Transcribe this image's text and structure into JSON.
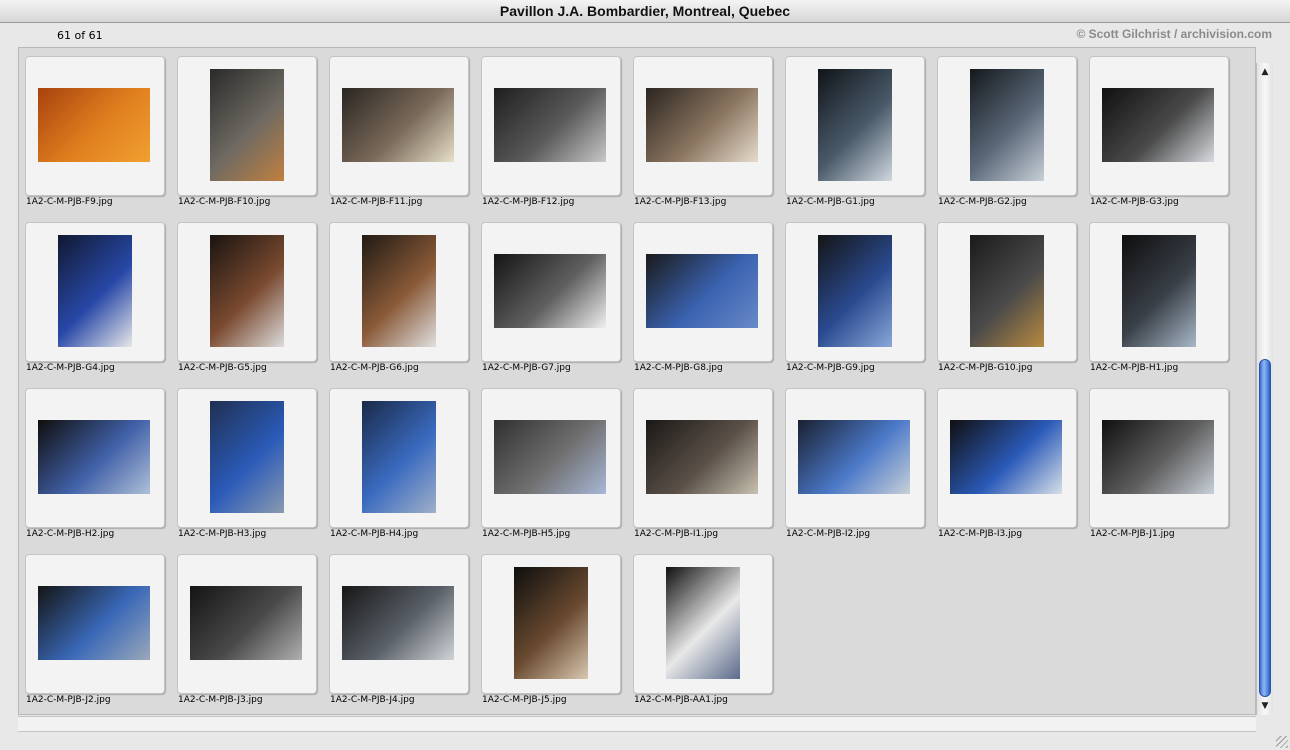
{
  "window": {
    "title": "Pavillon J.A. Bombardier, Montreal, Quebec"
  },
  "header": {
    "count": "61 of 61",
    "credit": "© Scott Gilchrist / archivision.com"
  },
  "thumbnails": [
    {
      "caption": "1A2-C-M-PJB-F9.jpg",
      "orientation": "landscape",
      "colors": [
        "#a8420e",
        "#e0801f",
        "#f0a030"
      ]
    },
    {
      "caption": "1A2-C-M-PJB-F10.jpg",
      "orientation": "portrait",
      "colors": [
        "#2a2a2a",
        "#6e6a62",
        "#c08040"
      ]
    },
    {
      "caption": "1A2-C-M-PJB-F11.jpg",
      "orientation": "landscape",
      "colors": [
        "#2a2622",
        "#7a6a5a",
        "#e8e0c8"
      ]
    },
    {
      "caption": "1A2-C-M-PJB-F12.jpg",
      "orientation": "landscape",
      "colors": [
        "#1e1e1e",
        "#5a5a5a",
        "#c8c8c8"
      ]
    },
    {
      "caption": "1A2-C-M-PJB-F13.jpg",
      "orientation": "landscape",
      "colors": [
        "#2c2520",
        "#8a7560",
        "#e6dccc"
      ]
    },
    {
      "caption": "1A2-C-M-PJB-G1.jpg",
      "orientation": "portrait",
      "colors": [
        "#101418",
        "#4a5a6a",
        "#d0d8e0"
      ]
    },
    {
      "caption": "1A2-C-M-PJB-G2.jpg",
      "orientation": "portrait",
      "colors": [
        "#14181c",
        "#5a6878",
        "#c8d0d8"
      ]
    },
    {
      "caption": "1A2-C-M-PJB-G3.jpg",
      "orientation": "landscape",
      "colors": [
        "#101010",
        "#4a4a4a",
        "#d8dce0"
      ]
    },
    {
      "caption": "1A2-C-M-PJB-G4.jpg",
      "orientation": "portrait",
      "colors": [
        "#101830",
        "#2848a8",
        "#e8e8e8"
      ]
    },
    {
      "caption": "1A2-C-M-PJB-G5.jpg",
      "orientation": "portrait",
      "colors": [
        "#1a1410",
        "#7a4a30",
        "#dcdcdc"
      ]
    },
    {
      "caption": "1A2-C-M-PJB-G6.jpg",
      "orientation": "portrait",
      "colors": [
        "#201a14",
        "#8a5a38",
        "#e0e0e0"
      ]
    },
    {
      "caption": "1A2-C-M-PJB-G7.jpg",
      "orientation": "landscape",
      "colors": [
        "#141414",
        "#606060",
        "#f0f0f0"
      ]
    },
    {
      "caption": "1A2-C-M-PJB-G8.jpg",
      "orientation": "landscape",
      "colors": [
        "#1a1a1a",
        "#3a62b0",
        "#6a8ac8"
      ]
    },
    {
      "caption": "1A2-C-M-PJB-G9.jpg",
      "orientation": "portrait",
      "colors": [
        "#141414",
        "#2a4a90",
        "#8aa8d8"
      ]
    },
    {
      "caption": "1A2-C-M-PJB-G10.jpg",
      "orientation": "portrait",
      "colors": [
        "#1a1a1a",
        "#4a4a4a",
        "#b88a40"
      ]
    },
    {
      "caption": "1A2-C-M-PJB-H1.jpg",
      "orientation": "portrait",
      "colors": [
        "#0e0e0e",
        "#3a4048",
        "#a8b8c8"
      ]
    },
    {
      "caption": "1A2-C-M-PJB-H2.jpg",
      "orientation": "landscape",
      "colors": [
        "#100e0c",
        "#4060a8",
        "#b0c0d8"
      ]
    },
    {
      "caption": "1A2-C-M-PJB-H3.jpg",
      "orientation": "portrait",
      "colors": [
        "#203050",
        "#2a5ab8",
        "#8a9ab0"
      ]
    },
    {
      "caption": "1A2-C-M-PJB-H4.jpg",
      "orientation": "portrait",
      "colors": [
        "#1a2a48",
        "#3a6ac0",
        "#a0b0c8"
      ]
    },
    {
      "caption": "1A2-C-M-PJB-H5.jpg",
      "orientation": "landscape",
      "colors": [
        "#303030",
        "#707070",
        "#a8b8d8"
      ]
    },
    {
      "caption": "1A2-C-M-PJB-I1.jpg",
      "orientation": "landscape",
      "colors": [
        "#1a1816",
        "#5a5048",
        "#c8c0b0"
      ]
    },
    {
      "caption": "1A2-C-M-PJB-I2.jpg",
      "orientation": "landscape",
      "colors": [
        "#1a2030",
        "#4a78c8",
        "#c8d0d8"
      ]
    },
    {
      "caption": "1A2-C-M-PJB-I3.jpg",
      "orientation": "landscape",
      "colors": [
        "#101010",
        "#2a5ab8",
        "#d8e0e8"
      ]
    },
    {
      "caption": "1A2-C-M-PJB-J1.jpg",
      "orientation": "landscape",
      "colors": [
        "#101010",
        "#606060",
        "#c8d0d8"
      ]
    },
    {
      "caption": "1A2-C-M-PJB-J2.jpg",
      "orientation": "landscape",
      "colors": [
        "#141414",
        "#3a68b8",
        "#9aa8b8"
      ]
    },
    {
      "caption": "1A2-C-M-PJB-J3.jpg",
      "orientation": "landscape",
      "colors": [
        "#141414",
        "#4a4a4a",
        "#b0b0b0"
      ]
    },
    {
      "caption": "1A2-C-M-PJB-J4.jpg",
      "orientation": "landscape",
      "colors": [
        "#161616",
        "#5a6068",
        "#d0d4d8"
      ]
    },
    {
      "caption": "1A2-C-M-PJB-J5.jpg",
      "orientation": "portrait",
      "colors": [
        "#0e0e0e",
        "#6a4a30",
        "#d8c8b0"
      ]
    },
    {
      "caption": "1A2-C-M-PJB-AA1.jpg",
      "orientation": "portrait",
      "colors": [
        "#101010",
        "#e8e8e8",
        "#5a6a8a"
      ]
    }
  ],
  "scrollbar": {
    "up_icon": "scroll-up-arrow-icon",
    "down_icon": "scroll-down-arrow-icon",
    "position": 0.68
  }
}
